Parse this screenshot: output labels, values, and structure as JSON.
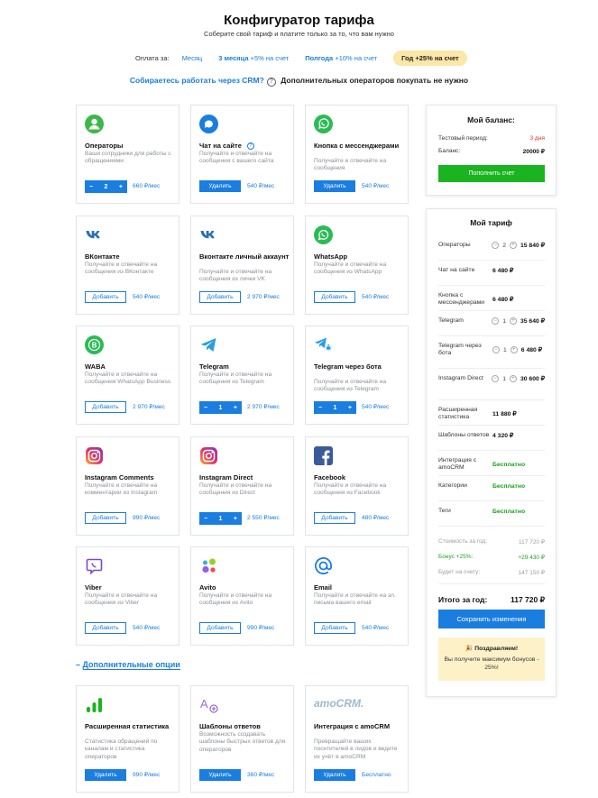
{
  "header": {
    "title": "Конфигуратор тарифа",
    "subtitle": "Соберите свой тариф и платите только за то, что вам нужно"
  },
  "payment": {
    "label": "Оплата за:",
    "options": [
      {
        "label": "Месяц",
        "bonus": ""
      },
      {
        "label": "3 месяца",
        "bonus": "+5% на счет"
      },
      {
        "label": "Полгода",
        "bonus": "+10% на счет"
      },
      {
        "label": "Год",
        "bonus": "+25% на счет"
      }
    ]
  },
  "crm": {
    "link": "Собираетесь работать через CRM?",
    "help": "?",
    "note": "Дополнительных операторов покупать не нужно"
  },
  "cards": [
    {
      "name": "Операторы",
      "desc": "Ваши сотрудники для работы с обращениями",
      "qty": "2",
      "price": "660 ₽/мес",
      "icon": "user-icon"
    },
    {
      "name": "Чат на сайте",
      "desc": "Получайте и отвечайте на сообщения с вашего сайта",
      "button": "Удалить",
      "price": "540 ₽/мес",
      "icon": "chat-bubble-icon",
      "help": "?"
    },
    {
      "name": "Кнопка с мессенджерами",
      "desc": "Получайте и отвечайте на сообщения",
      "button": "Удалить",
      "price": "540 ₽/мес",
      "icon": "whatsapp-bubble-icon"
    },
    {
      "name": "ВКонтакте",
      "desc": "Получайте и отвечайте на сообщения из ВКонтакте",
      "button": "Добавить",
      "price": "540 ₽/мес",
      "icon": "vk-icon"
    },
    {
      "name": "Вконтакте личный аккаунт",
      "desc": "Получайте и отвечайте на сообщения из лички VK",
      "button": "Добавить",
      "price": "2 970 ₽/мес",
      "icon": "vk-icon"
    },
    {
      "name": "WhatsApp",
      "desc": "Получайте и отвечайте на сообщения из WhatsApp",
      "button": "Добавить",
      "price": "540 ₽/мес",
      "icon": "whatsapp-icon"
    },
    {
      "name": "WABA",
      "desc": "Получайте и отвечайте на сообщения WhatsApp Business",
      "button": "Добавить",
      "price": "2 970 ₽/мес",
      "icon": "whatsapp-business-icon"
    },
    {
      "name": "Telegram",
      "desc": "Получайте и отвечайте на сообщения из Telegram",
      "qty": "1",
      "price": "2 970 ₽/мес",
      "icon": "telegram-icon"
    },
    {
      "name": "Telegram через бота",
      "desc": "Получайте и отвечайте на сообщения из Telegram",
      "qty": "1",
      "price": "540 ₽/мес",
      "icon": "telegram-bot-icon"
    },
    {
      "name": "Instagram Comments",
      "desc": "Получайте и отвечайте на комментарии из Instagram",
      "button": "Добавить",
      "price": "990 ₽/мес",
      "icon": "instagram-icon"
    },
    {
      "name": "Instagram Direct",
      "desc": "Получайте и отвечайте на сообщения из Direct",
      "qty": "1",
      "price": "2 550 ₽/мес",
      "icon": "instagram-icon"
    },
    {
      "name": "Facebook",
      "desc": "Получайте и отвечайте на сообщения из Facebook",
      "button": "Добавить",
      "price": "480 ₽/мес",
      "icon": "facebook-icon"
    },
    {
      "name": "Viber",
      "desc": "Получайте и отвечайте на сообщения из Viber",
      "button": "Добавить",
      "price": "540 ₽/мес",
      "icon": "viber-icon"
    },
    {
      "name": "Avito",
      "desc": "Получайте и отвечайте на сообщения из Avito",
      "button": "Добавить",
      "price": "990 ₽/мес",
      "icon": "avito-icon"
    },
    {
      "name": "Email",
      "desc": "Получайте и отвечайте на эл. письма вашего email",
      "button": "Добавить",
      "price": "540 ₽/мес",
      "icon": "email-at-icon"
    }
  ],
  "additional": {
    "toggle": "–",
    "label": "Дополнительные опции",
    "cards": [
      {
        "name": "Расширенная статистика",
        "desc": "Статистика обращений по каналам и статистика операторов",
        "button": "Удалить",
        "price": "990 ₽/мес",
        "icon": "bar-chart-icon"
      },
      {
        "name": "Шаблоны ответов",
        "desc": "Возможность создавать шаблоны быстрых ответов для операторов",
        "button": "Удалить",
        "price": "360 ₽/мес",
        "icon": "templates-icon"
      },
      {
        "name": "Интеграция с amoCRM",
        "desc": "Превращайте ваших посетителей в лидов и ведите их учёт в amoCRM",
        "button": "Удалить",
        "price": "Бесплатно",
        "icon": "amocrm-logo",
        "logo": "amoCRM."
      }
    ]
  },
  "balance": {
    "title": "Мой баланс:",
    "trial_label": "Тестовый период:",
    "trial_value": "3 дня",
    "balance_label": "Баланс:",
    "balance_value": "20000 ₽",
    "topup": "Пополнить счет"
  },
  "tariff": {
    "title": "Мой тариф",
    "rows": [
      {
        "name": "Операторы",
        "qty": "2",
        "price": "15 840 ₽"
      },
      {
        "name": "Чат на сайте",
        "price": "6 480 ₽"
      },
      {
        "name": "Кнопка с мессенджерами",
        "price": "6 480 ₽"
      },
      {
        "name": "Telegram",
        "qty": "1",
        "price": "35 640 ₽"
      },
      {
        "name": "Telegram через бота",
        "qty": "1",
        "price": "6 480 ₽"
      },
      {
        "name": "Instagram Direct",
        "qty": "1",
        "price": "30 600 ₽"
      },
      {
        "name": "Расширенная статистика",
        "price": "11 880 ₽"
      },
      {
        "name": "Шаблоны ответов",
        "price": "4 320 ₽"
      },
      {
        "name": "Интеграция с amoCRM",
        "price": "Бесплатно",
        "free": true
      },
      {
        "name": "Категории",
        "price": "Бесплатно",
        "free": true
      },
      {
        "name": "Теги",
        "price": "Бесплатно",
        "free": true
      }
    ],
    "cost_label": "Стоимость за год:",
    "cost_value": "117 720 ₽",
    "bonus_label": "Бонус +25%:",
    "bonus_value": "+29 430 ₽",
    "onaccount_label": "Будет на счету:",
    "onaccount_value": "147 150 ₽",
    "total_label": "Итого за год:",
    "total_value": "117 720 ₽",
    "save": "Сохранить изменения",
    "congrats_title": "🎉 Поздравляем!",
    "congrats_body": "Вы получите максимум бонусов - 25%!"
  },
  "colors": {
    "accent": "#1a7de0",
    "green": "#19b41f",
    "red": "#e0352b",
    "highlight": "#fbe7a8"
  }
}
